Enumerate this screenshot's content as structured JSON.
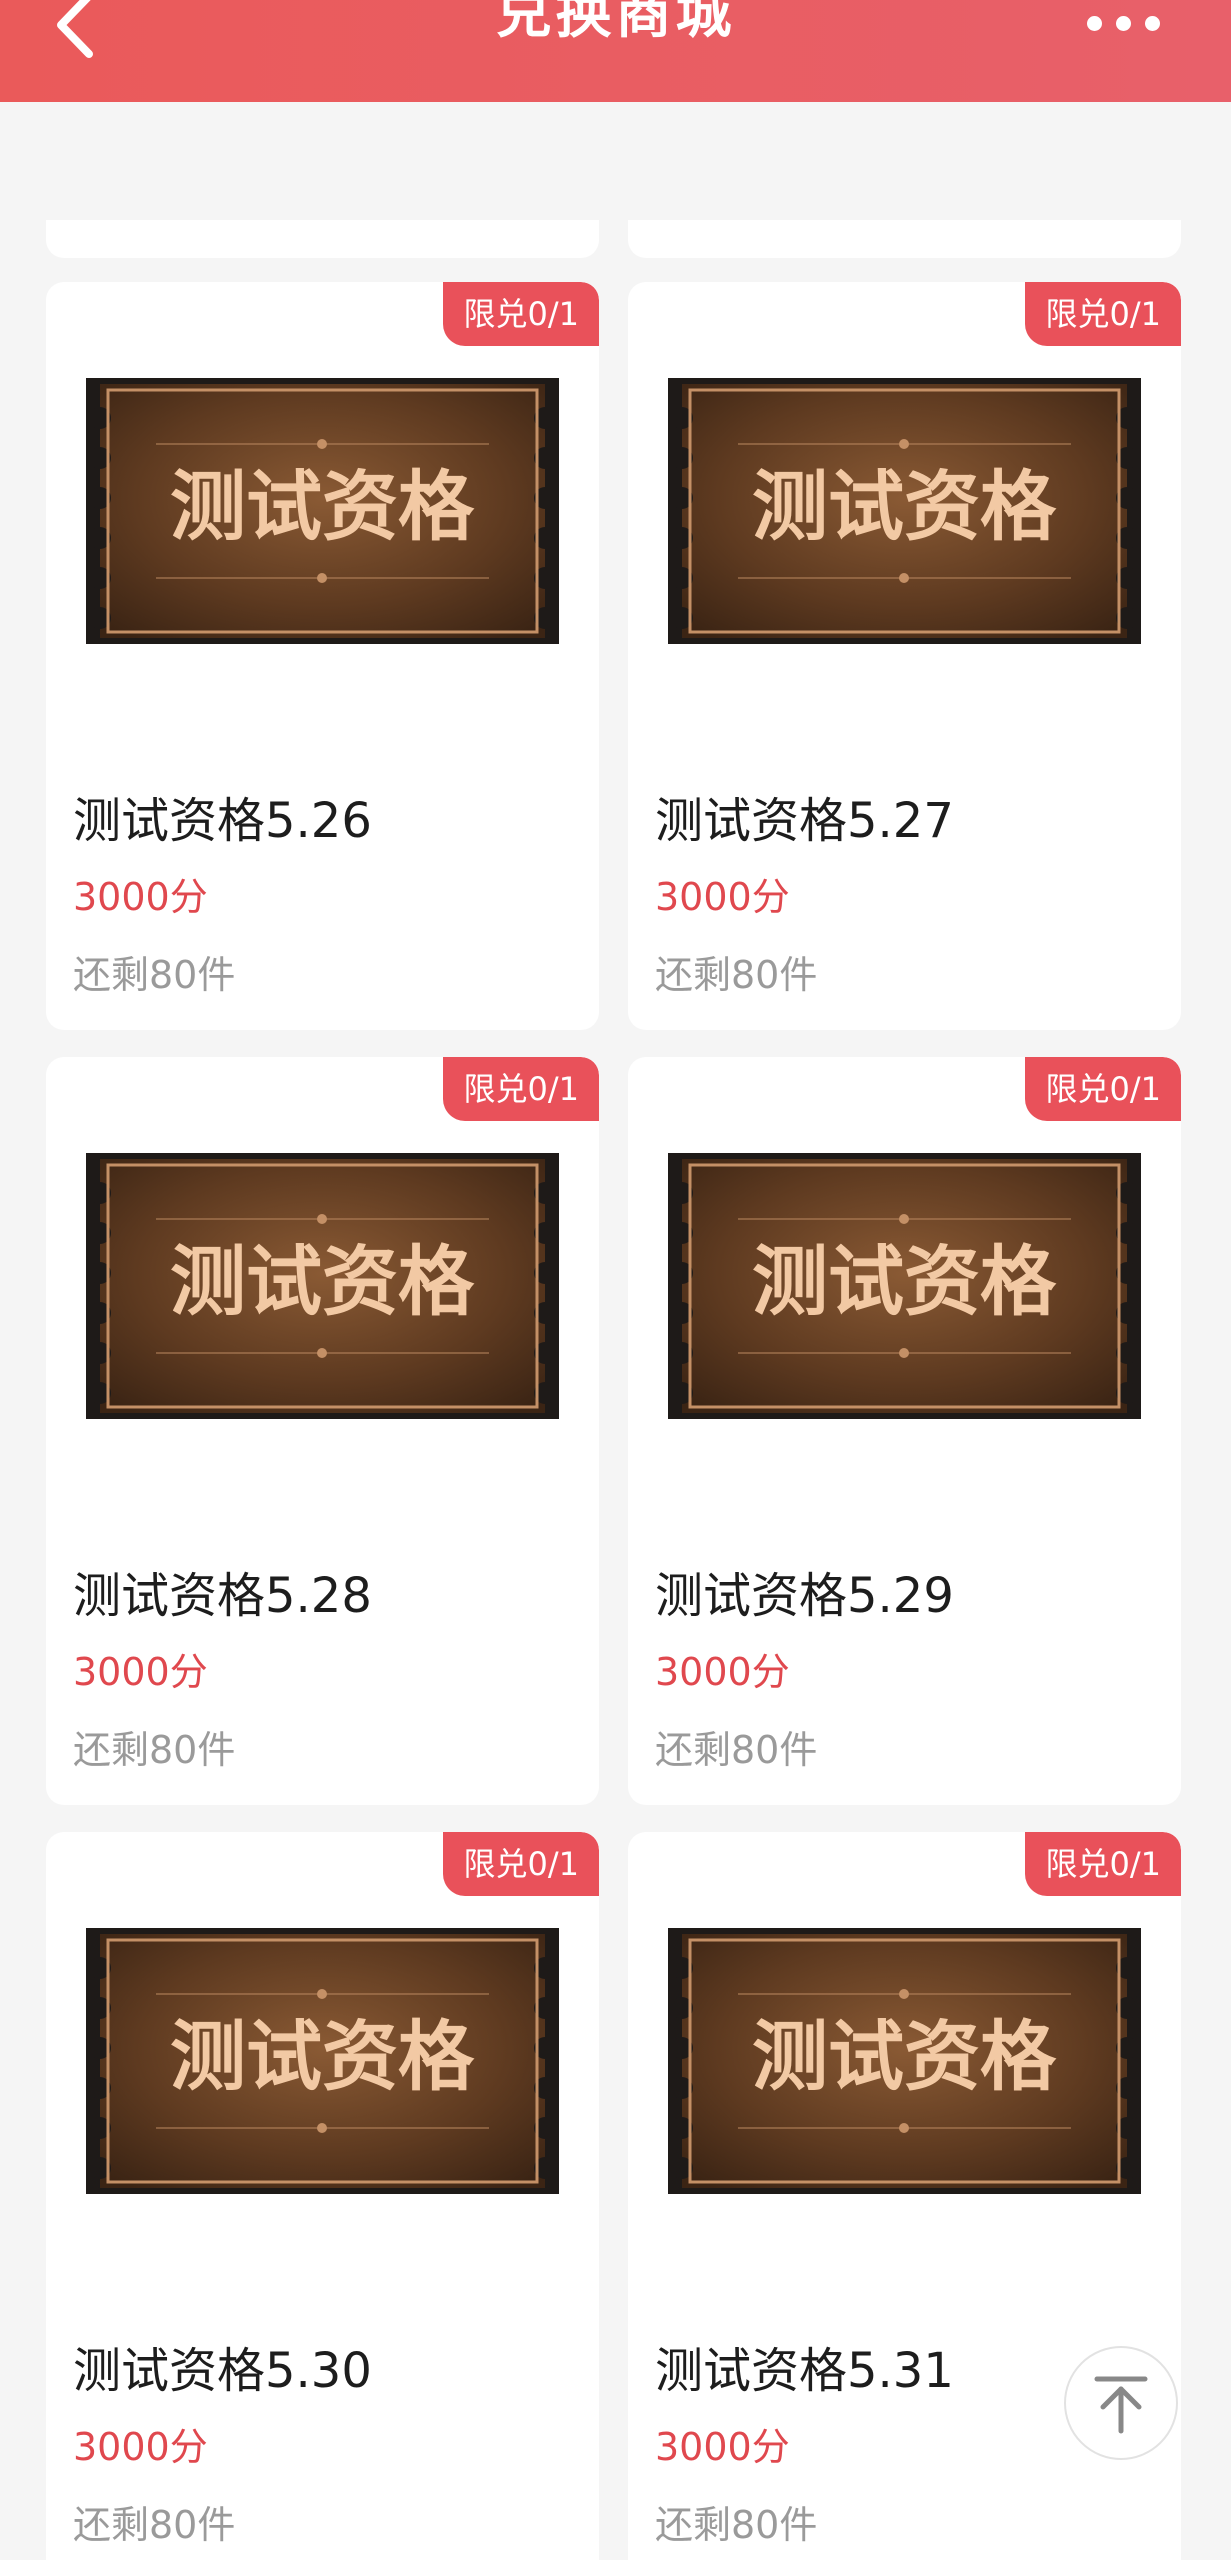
{
  "header": {
    "title": "兑换商城",
    "back_icon": "chevron-left-icon",
    "more_icon": "more-horizontal-icon"
  },
  "ticket_art_text": "测试资格",
  "items": [
    {
      "name": "测试资格5.26",
      "price": "3000分",
      "stock": "还剩80件",
      "limit": "限兑0/1"
    },
    {
      "name": "测试资格5.27",
      "price": "3000分",
      "stock": "还剩80件",
      "limit": "限兑0/1"
    },
    {
      "name": "测试资格5.28",
      "price": "3000分",
      "stock": "还剩80件",
      "limit": "限兑0/1"
    },
    {
      "name": "测试资格5.29",
      "price": "3000分",
      "stock": "还剩80件",
      "limit": "限兑0/1"
    },
    {
      "name": "测试资格5.30",
      "price": "3000分",
      "stock": "还剩80件",
      "limit": "限兑0/1"
    },
    {
      "name": "测试资格5.31",
      "price": "3000分",
      "stock": "还剩80件",
      "limit": "限兑0/1"
    }
  ],
  "back_to_top_icon": "arrow-up-to-top-icon",
  "colors": {
    "accent": "#e9515a",
    "header": "#ea5a5a",
    "price": "#e0484e"
  }
}
